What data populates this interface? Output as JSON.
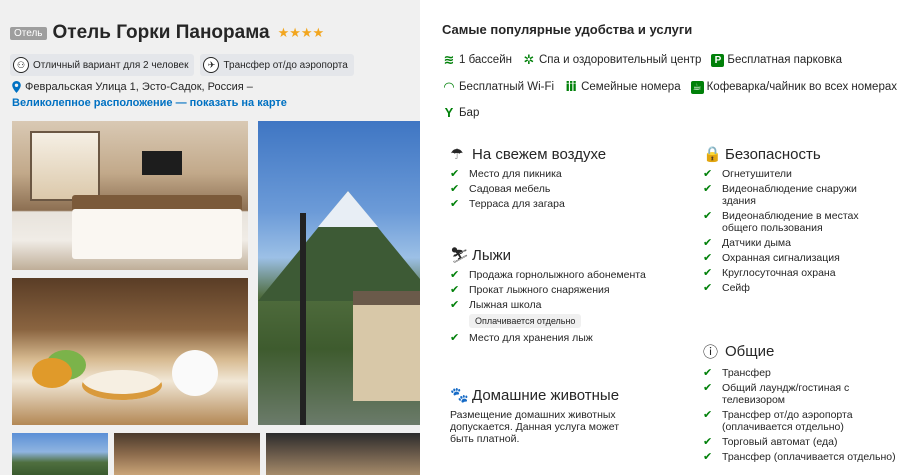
{
  "hotel": {
    "badge": "Отель",
    "name": "Отель Горки Панорама",
    "stars": "★★★★",
    "chips": [
      {
        "icon": "couple-icon",
        "label": "Отличный вариант для 2 человек"
      },
      {
        "icon": "airport-transfer-icon",
        "label": "Трансфер от/до аэропорта"
      }
    ],
    "address": "Февральская Улица 1, Эсто-Садок, Россия –",
    "map_link": "Великолепное расположение — показать на карте"
  },
  "popular": {
    "title": "Самые популярные удобства и услуги",
    "rows": [
      [
        {
          "icon": "pool-icon",
          "glyph": "≋",
          "label": "1 бассейн"
        },
        {
          "icon": "spa-icon",
          "glyph": "✲",
          "label": "Спа и оздоровительный центр"
        },
        {
          "icon": "parking-icon",
          "glyph": "P",
          "label": "Бесплатная парковка"
        }
      ],
      [
        {
          "icon": "wifi-icon",
          "glyph": "◠",
          "label": "Бесплатный Wi-Fi"
        },
        {
          "icon": "family-icon",
          "glyph": "👪",
          "label": "Семейные номера"
        },
        {
          "icon": "kettle-icon",
          "glyph": "☕",
          "label": "Кофеварка/чайник во всех номерах"
        }
      ],
      [
        {
          "icon": "bar-icon",
          "glyph": "Y",
          "label": "Бар"
        }
      ]
    ]
  },
  "sections": {
    "outdoors": {
      "title": "На свежем воздухе",
      "items": [
        "Место для пикника",
        "Садовая мебель",
        "Терраса для загара"
      ]
    },
    "ski": {
      "title": "Лыжи",
      "items": [
        "Продажа горнолыжного абонемента",
        "Прокат лыжного снаряжения",
        "Лыжная школа",
        "Место для хранения лыж"
      ],
      "paid_note": "Оплачивается отдельно"
    },
    "pets": {
      "title": "Домашние животные",
      "text": "Размещение домашних животных допускается. Данная услуга может быть платной."
    },
    "security": {
      "title": "Безопасность",
      "items": [
        "Огнетушители",
        "Видеонаблюдение снаружи здания",
        "Видеонаблюдение в местах общего пользования",
        "Датчики дыма",
        "Охранная сигнализация",
        "Круглосуточная охрана",
        "Сейф"
      ]
    },
    "general": {
      "title": "Общие",
      "items": [
        "Трансфер",
        "Общий лаундж/гостиная с телевизором",
        "Трансфер от/до аэропорта (оплачивается отдельно)",
        "Торговый автомат (еда)",
        "Трансфер (оплачивается отдельно)"
      ]
    }
  },
  "colors": {
    "accent_green": "#008009",
    "link_blue": "#0071c2",
    "star_gold": "#f2a61f"
  }
}
